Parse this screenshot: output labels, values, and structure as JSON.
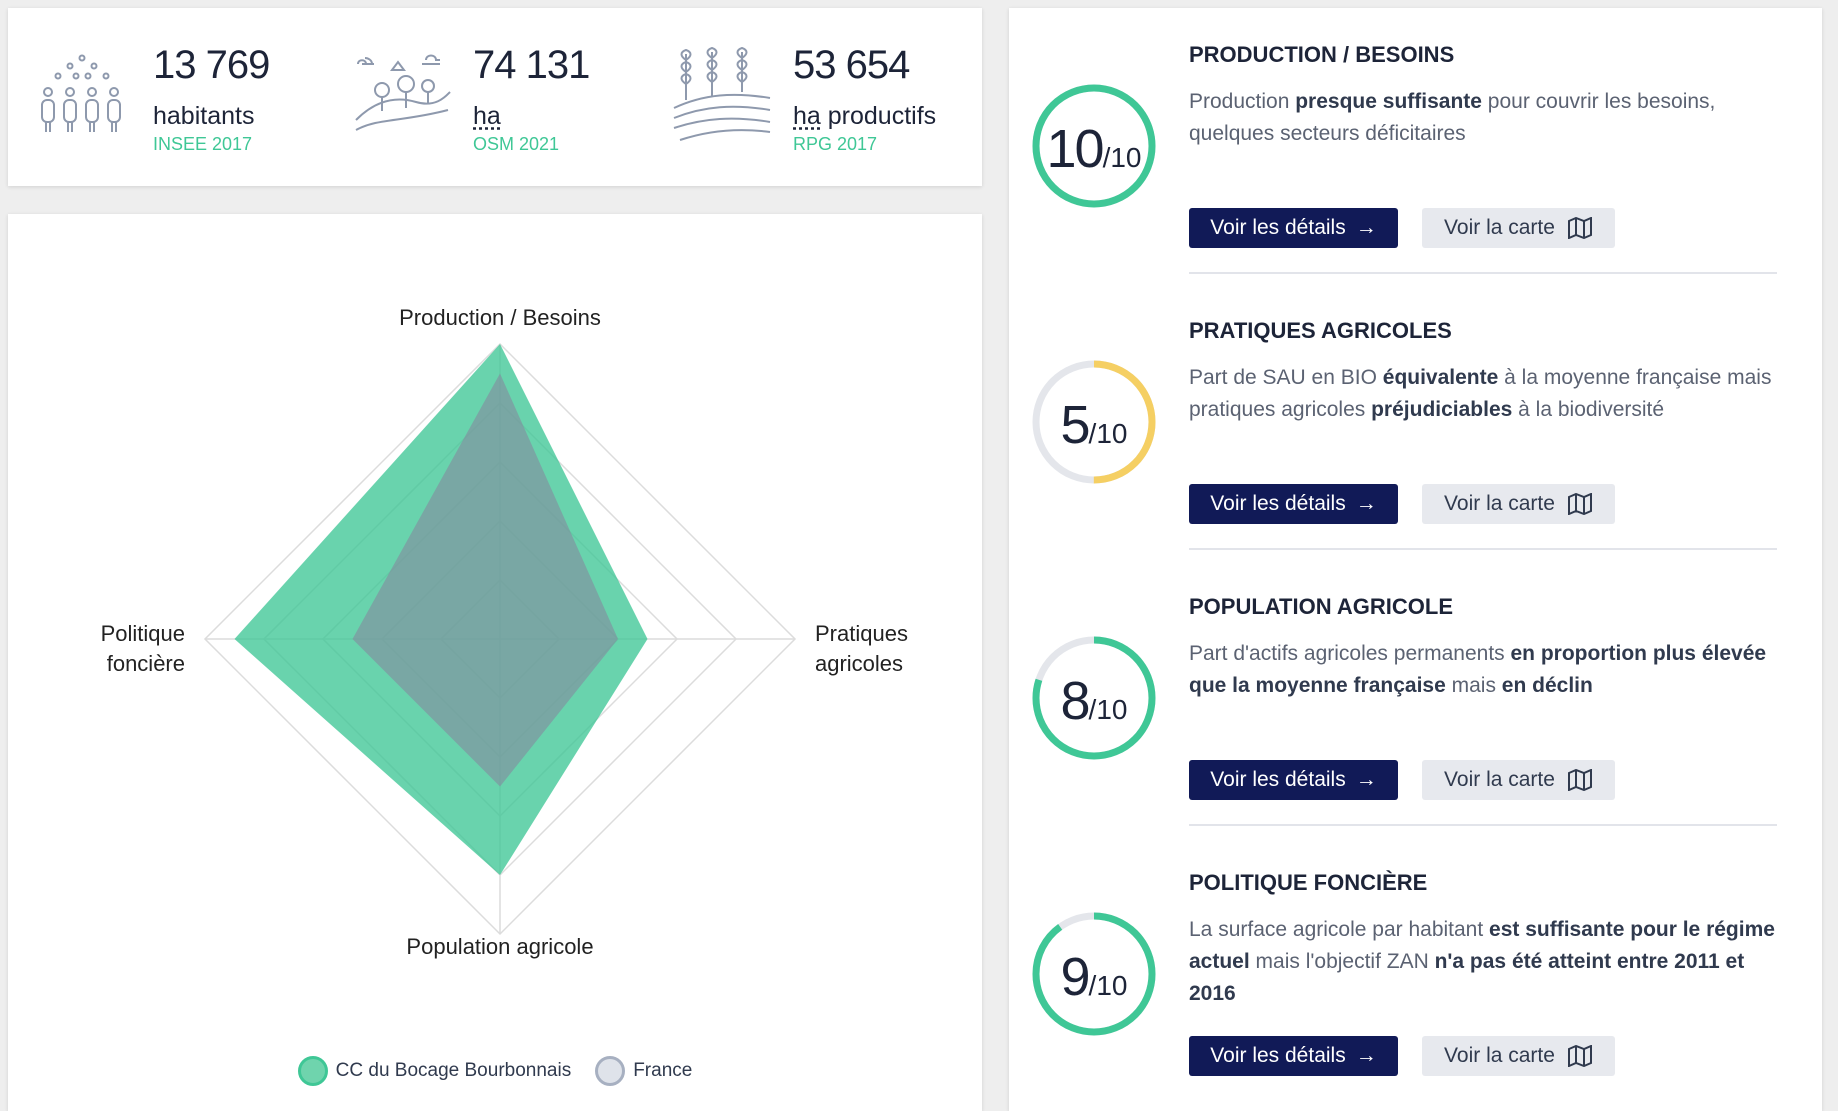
{
  "stats": [
    {
      "value": "13 769",
      "label": "habitants",
      "unit": "",
      "source": "INSEE 2017",
      "icon": "population-icon"
    },
    {
      "value": "74 131",
      "label": "",
      "unit": "ha",
      "source": "OSM 2021",
      "icon": "landscape-icon"
    },
    {
      "value": "53 654",
      "label": " productifs",
      "unit": "ha",
      "source": "RPG 2017",
      "icon": "crops-field-icon"
    }
  ],
  "chart_data": {
    "type": "radar",
    "axes": [
      "Production / Besoins",
      "Pratiques agricoles",
      "Population agricole",
      "Politique foncière"
    ],
    "max": 10,
    "series": [
      {
        "name": "CC du Bocage Bourbonnais",
        "values": [
          10,
          5,
          8,
          9
        ],
        "color": "#3fc796"
      },
      {
        "name": "France",
        "values": [
          9,
          4,
          5,
          5
        ],
        "color": "#8e9bb0"
      }
    ],
    "grid_levels": [
      2,
      4,
      6,
      8,
      10
    ]
  },
  "radar_labels": {
    "top": "Production / Besoins",
    "right_line1": "Pratiques",
    "right_line2": "agricoles",
    "bottom": "Population agricole",
    "left_line1": "Politique",
    "left_line2": "foncière"
  },
  "legend": [
    {
      "name": "CC du Bocage Bourbonnais",
      "color": "#3fc796"
    },
    {
      "name": "France",
      "color": "#a7b0c1"
    }
  ],
  "indicators": [
    {
      "title": "PRODUCTION / BESOINS",
      "score": "10",
      "out_of": "/10",
      "score_value": 10,
      "color": "#3fc796",
      "desc_parts": [
        "Production ",
        "presque suffisante",
        " pour couvrir les besoins, quelques secteurs déficitaires"
      ]
    },
    {
      "title": "PRATIQUES AGRICOLES",
      "score": "5",
      "out_of": "/10",
      "score_value": 5,
      "color": "#f5cf63",
      "desc_parts": [
        "Part de SAU en BIO ",
        "équivalente",
        " à la moyenne française mais pratiques agricoles ",
        "préjudiciables",
        " à la biodiversité"
      ]
    },
    {
      "title": "POPULATION AGRICOLE",
      "score": "8",
      "out_of": "/10",
      "score_value": 8,
      "color": "#3fc796",
      "desc_parts": [
        "Part d'actifs agricoles permanents ",
        "en proportion plus élevée que la moyenne française",
        " mais ",
        "en déclin"
      ]
    },
    {
      "title": "POLITIQUE FONCIÈRE",
      "score": "9",
      "out_of": "/10",
      "score_value": 9,
      "color": "#3fc796",
      "desc_parts": [
        "La surface agricole par habitant ",
        "est suffisante pour le régime actuel",
        " mais l'objectif ZAN ",
        "n'a pas été atteint entre 2011 et 2016"
      ]
    }
  ],
  "buttons": {
    "details_label": "Voir les détails",
    "map_label": "Voir la carte"
  }
}
